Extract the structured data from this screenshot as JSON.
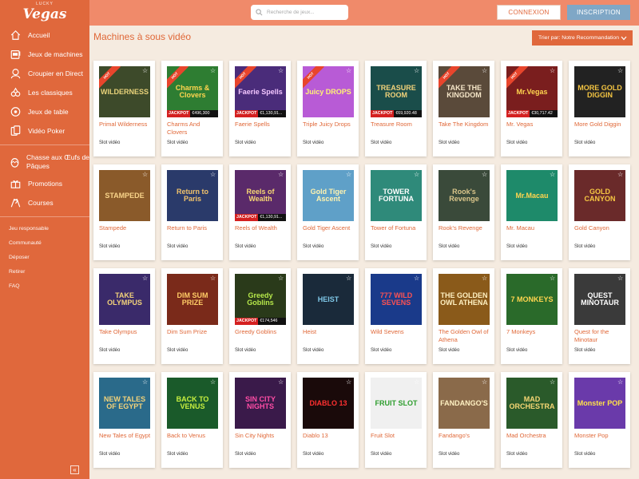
{
  "logo": {
    "mini": "LUCKY",
    "text": "Vegas"
  },
  "nav": {
    "items": [
      {
        "label": "Accueil",
        "icon": "home-icon"
      },
      {
        "label": "Jeux de machines",
        "icon": "slot-machine-icon"
      },
      {
        "label": "Croupier en Direct",
        "icon": "live-dealer-icon"
      },
      {
        "label": "Les classiques",
        "icon": "classics-icon"
      },
      {
        "label": "Jeux de table",
        "icon": "table-games-icon"
      },
      {
        "label": "Vidéo Poker",
        "icon": "video-poker-icon"
      },
      {
        "label": "Chasse aux Œufs de Pâques",
        "icon": "easter-egg-icon"
      },
      {
        "label": "Promotions",
        "icon": "gift-icon"
      },
      {
        "label": "Courses",
        "icon": "flags-icon"
      }
    ],
    "sub": [
      "Jeu responsable",
      "Communauté",
      "Déposer",
      "Retirer",
      "FAQ"
    ],
    "collapse": "«"
  },
  "header": {
    "search_placeholder": "Recherche de jeux...",
    "login": "CONNEXION",
    "signup": "INSCRIPTION"
  },
  "main": {
    "title": "Machines à sous vidéo",
    "sort_label": "Trier par: Notre Recommandation",
    "badge_label": "HOT",
    "jackpot_label": "JACKPOT"
  },
  "colors": {
    "sidebar": "#e0683c",
    "topbar": "#f08a6a",
    "accent": "#e06838",
    "signup": "#7fa7c6",
    "background": "#f5ebe0"
  },
  "games": [
    [
      {
        "name": "Primal Wilderness",
        "type": "Slot vidéo",
        "hot": true,
        "art": "WILDERNESS",
        "bg": "#3d4a2a",
        "fg": "#e8d27a"
      },
      {
        "name": "Charms And Clovers",
        "type": "Slot vidéo",
        "hot": true,
        "jackpot": "€496,300",
        "art": "Charms & Clovers",
        "bg": "#2e7d32",
        "fg": "#ffd54f"
      },
      {
        "name": "Faerie Spells",
        "type": "Slot vidéo",
        "hot": true,
        "jackpot": "€1,130,91...",
        "art": "Faerie Spells",
        "bg": "#4a2c7a",
        "fg": "#f3c6ff"
      },
      {
        "name": "Triple Juicy Drops",
        "type": "Slot vidéo",
        "hot": true,
        "art": "Juicy DROPS",
        "bg": "#b85bd6",
        "fg": "#fff176"
      },
      {
        "name": "Treasure Room",
        "type": "Slot vidéo",
        "jackpot": "€69,920.48",
        "art": "TREASURE ROOM",
        "bg": "#1a4d4a",
        "fg": "#f2d27a"
      },
      {
        "name": "Take The Kingdom",
        "type": "Slot vidéo",
        "hot": true,
        "art": "TAKE THE KINGDOM",
        "bg": "#5a4a3a",
        "fg": "#f5e6c8"
      },
      {
        "name": "Mr. Vegas",
        "type": "Slot vidéo",
        "hot": true,
        "jackpot": "€30,717.42",
        "art": "Mr.Vegas",
        "bg": "#7a1e1e",
        "fg": "#ffd54f"
      },
      {
        "name": "More Gold Diggin",
        "type": "Slot vidéo",
        "art": "MORE GOLD DIGGIN",
        "bg": "#222222",
        "fg": "#f4c542"
      }
    ],
    [
      {
        "name": "Stampede",
        "type": "Slot vidéo",
        "art": "STAMPEDE",
        "bg": "#8a5a2a",
        "fg": "#f9d48a"
      },
      {
        "name": "Return to Paris",
        "type": "Slot vidéo",
        "art": "Return to Paris",
        "bg": "#2a3a6a",
        "fg": "#f2c36b"
      },
      {
        "name": "Reels of Wealth",
        "type": "Slot vidéo",
        "jackpot": "€1,130,91...",
        "art": "Reels of Wealth",
        "bg": "#5a2a6a",
        "fg": "#f7d774"
      },
      {
        "name": "Gold Tiger Ascent",
        "type": "Slot vidéo",
        "art": "Gold Tiger Ascent",
        "bg": "#5fa0c8",
        "fg": "#fff3b0"
      },
      {
        "name": "Tower of Fortuna",
        "type": "Slot vidéo",
        "art": "TOWER FORTUNA",
        "bg": "#2f8a7a",
        "fg": "#ffffff"
      },
      {
        "name": "Rook's Revenge",
        "type": "Slot vidéo",
        "art": "Rook's Revenge",
        "bg": "#3a4a3a",
        "fg": "#d9c58a"
      },
      {
        "name": "Mr. Macau",
        "type": "Slot vidéo",
        "art": "Mr.Macau",
        "bg": "#1e8a6a",
        "fg": "#ffd54f"
      },
      {
        "name": "Gold Canyon",
        "type": "Slot vidéo",
        "art": "GOLD CANYON",
        "bg": "#6a2a2a",
        "fg": "#f7c843"
      }
    ],
    [
      {
        "name": "Take Olympus",
        "type": "Slot vidéo",
        "art": "TAKE OLYMPUS",
        "bg": "#3a2a6a",
        "fg": "#f2d27a"
      },
      {
        "name": "Dim Sum Prize",
        "type": "Slot vidéo",
        "art": "DIM SUM PRIZE",
        "bg": "#7a2a1a",
        "fg": "#ffcc66"
      },
      {
        "name": "Greedy Goblins",
        "type": "Slot vidéo",
        "jackpot": "€174,546",
        "art": "Greedy Goblins",
        "bg": "#2a3a1a",
        "fg": "#b6e84a"
      },
      {
        "name": "Heist",
        "type": "Slot vidéo",
        "art": "HEIST",
        "bg": "#1a2a3a",
        "fg": "#7fc8e8"
      },
      {
        "name": "Wild Sevens",
        "type": "Slot vidéo",
        "art": "777 WILD SEVENS",
        "bg": "#1a3a8a",
        "fg": "#ff5252"
      },
      {
        "name": "The Golden Owl of Athena",
        "type": "Slot vidéo",
        "art": "THE GOLDEN OWL ATHENA",
        "bg": "#8a5a1a",
        "fg": "#fff1c2"
      },
      {
        "name": "7 Monkeys",
        "type": "Slot vidéo",
        "art": "7 MONKEYS",
        "bg": "#2a6a2a",
        "fg": "#ffd54f"
      },
      {
        "name": "Quest for the Minotaur",
        "type": "Slot vidéo",
        "art": "QUEST MINOTAUR",
        "bg": "#3a3a3a",
        "fg": "#ffffff"
      }
    ],
    [
      {
        "name": "New Tales of Egypt",
        "type": "Slot vidéo",
        "art": "NEW TALES OF EGYPT",
        "bg": "#2a6a8a",
        "fg": "#f2d27a"
      },
      {
        "name": "Back to Venus",
        "type": "Slot vidéo",
        "art": "BACK TO VENUS",
        "bg": "#1a5a2a",
        "fg": "#c8f040"
      },
      {
        "name": "Sin City Nights",
        "type": "Slot vidéo",
        "art": "SIN CITY NIGHTS",
        "bg": "#3a1a4a",
        "fg": "#ff4da6"
      },
      {
        "name": "Diablo 13",
        "type": "Slot vidéo",
        "art": "DIABLO 13",
        "bg": "#1a0a0a",
        "fg": "#ff3030"
      },
      {
        "name": "Fruit Slot",
        "type": "Slot vidéo",
        "art": "FRUIT SLOT",
        "bg": "#f0f0f0",
        "fg": "#2e9e2e"
      },
      {
        "name": "Fandango's",
        "type": "Slot vidéo",
        "art": "FANDANGO'S",
        "bg": "#8a6a4a",
        "fg": "#fff1c2"
      },
      {
        "name": "Mad Orchestra",
        "type": "Slot vidéo",
        "art": "MAD ORCHESTRA",
        "bg": "#2a5a2a",
        "fg": "#f7d774"
      },
      {
        "name": "Monster Pop",
        "type": "Slot vidéo",
        "art": "Monster POP",
        "bg": "#6a3aaa",
        "fg": "#ffe14a"
      }
    ]
  ]
}
